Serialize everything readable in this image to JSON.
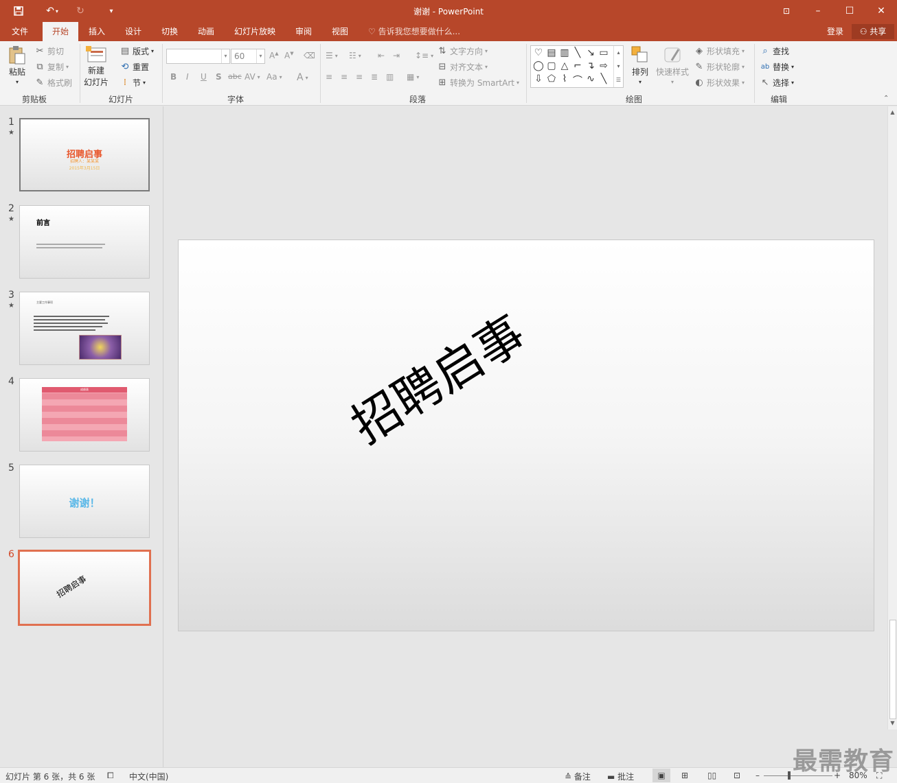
{
  "window": {
    "title": "谢谢 - PowerPoint",
    "minimize": "–",
    "maximize": "☐",
    "close": "✕",
    "ribbon_display": "⊡"
  },
  "quick_access": {
    "save_icon": "save-icon",
    "undo_icon": "undo-icon",
    "redo_icon": "redo-icon",
    "customize_icon": "customize-icon"
  },
  "tabs": [
    "文件",
    "开始",
    "插入",
    "设计",
    "切换",
    "动画",
    "幻灯片放映",
    "审阅",
    "视图"
  ],
  "active_tab": "开始",
  "tell_me": "告诉我您想要做什么...",
  "account": {
    "login": "登录",
    "share": "共享"
  },
  "ribbon": {
    "clipboard": {
      "label": "剪贴板",
      "paste": "粘贴",
      "cut": "剪切",
      "copy": "复制",
      "format_painter": "格式刷"
    },
    "slides": {
      "label": "幻灯片",
      "new_slide_1": "新建",
      "new_slide_2": "幻灯片",
      "layout": "版式",
      "reset": "重置",
      "section": "节"
    },
    "font": {
      "label": "字体",
      "font_name": "",
      "font_size": "60",
      "bold": "B",
      "italic": "I",
      "underline": "U",
      "shadow": "S",
      "strike": "abc",
      "spacing": "AV",
      "case": "Aa",
      "color": "A"
    },
    "paragraph": {
      "label": "段落",
      "text_direction": "文字方向",
      "align_text": "对齐文本",
      "smartart": "转换为 SmartArt"
    },
    "drawing": {
      "label": "绘图",
      "arrange": "排列",
      "quick_styles": "快速样式",
      "shape_fill": "形状填充",
      "shape_outline": "形状轮廓",
      "shape_effects": "形状效果"
    },
    "editing": {
      "label": "编辑",
      "find": "查找",
      "replace": "替换",
      "select": "选择"
    }
  },
  "thumbnails": [
    {
      "num": "1",
      "star": "★",
      "title": "招聘启事",
      "subtitle": "招聘人：某某某",
      "date": "2015年3月15日"
    },
    {
      "num": "2",
      "star": "★",
      "title": "前言"
    },
    {
      "num": "3",
      "star": "★",
      "title": "主要工作事项"
    },
    {
      "num": "4",
      "title": "成绩表"
    },
    {
      "num": "5",
      "title": "谢谢！"
    },
    {
      "num": "6",
      "title": "招聘启事"
    }
  ],
  "current_slide": {
    "text": "招聘启事"
  },
  "status": {
    "slide_info": "幻灯片 第 6 张，共 6 张",
    "language": "中文(中国)",
    "notes": "备注",
    "comments": "批注",
    "zoom": "80%"
  },
  "watermark": "最需教育",
  "colors": {
    "accent": "#b7472a",
    "selected_thumb": "#e07050"
  }
}
